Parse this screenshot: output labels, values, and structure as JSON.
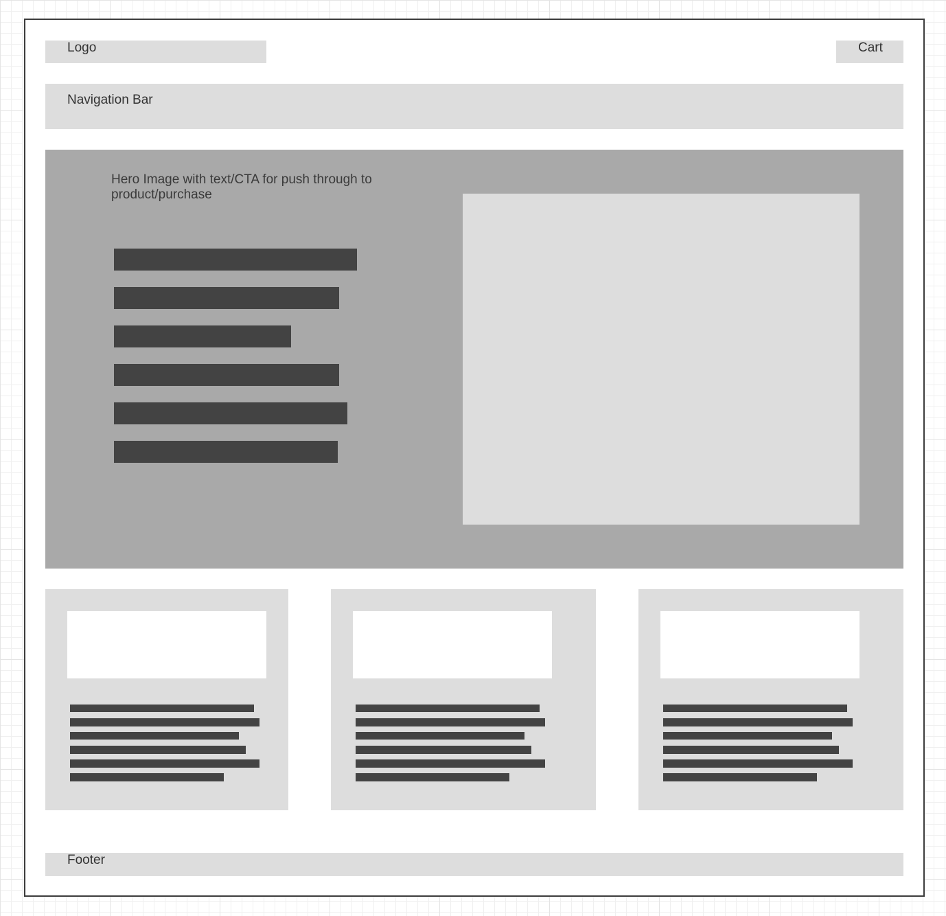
{
  "header": {
    "logo_label": "Logo",
    "cart_label": "Cart"
  },
  "nav": {
    "label": "Navigation Bar"
  },
  "hero": {
    "text": "Hero Image with text/CTA for push through to product/purchase"
  },
  "footer": {
    "label": "Footer"
  },
  "colors": {
    "placeholder_light": "#dddddd",
    "hero_background": "#a9a9a9",
    "text_bar": "#434343",
    "frame_border": "#3c3c3c"
  }
}
